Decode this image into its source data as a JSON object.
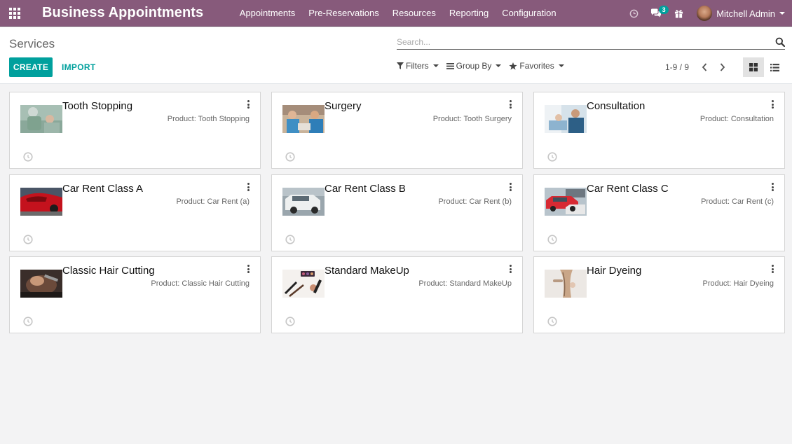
{
  "navbar": {
    "brand": "Business Appointments",
    "menu": [
      "Appointments",
      "Pre-Reservations",
      "Resources",
      "Reporting",
      "Configuration"
    ],
    "messages_count": "3",
    "user_name": "Mitchell Admin",
    "bg_color": "#875a7b"
  },
  "control_panel": {
    "breadcrumb": "Services",
    "create_label": "CREATE",
    "import_label": "IMPORT",
    "search_placeholder": "Search...",
    "filters_label": "Filters",
    "group_by_label": "Group By",
    "favorites_label": "Favorites",
    "pager": "1-9 / 9",
    "accent_color": "#00a09d"
  },
  "cards": [
    {
      "title": "Tooth Stopping",
      "product": "Product: Tooth Stopping",
      "image": "dentist-photo"
    },
    {
      "title": "Surgery",
      "product": "Product: Tooth Surgery",
      "image": "surgery-photo"
    },
    {
      "title": "Consultation",
      "product": "Product: Consultation",
      "image": "consultation-photo"
    },
    {
      "title": "Car Rent Class A",
      "product": "Product: Car Rent (a)",
      "image": "red-car-photo"
    },
    {
      "title": "Car Rent Class B",
      "product": "Product: Car Rent (b)",
      "image": "white-suv-photo"
    },
    {
      "title": "Car Rent Class C",
      "product": "Product: Car Rent (c)",
      "image": "parking-lot-photo"
    },
    {
      "title": "Classic Hair Cutting",
      "product": "Product: Classic Hair Cutting",
      "image": "haircut-photo"
    },
    {
      "title": "Standard MakeUp",
      "product": "Product: Standard MakeUp",
      "image": "makeup-photo"
    },
    {
      "title": "Hair Dyeing",
      "product": "Product: Hair Dyeing",
      "image": "hair-dyeing-photo"
    }
  ]
}
